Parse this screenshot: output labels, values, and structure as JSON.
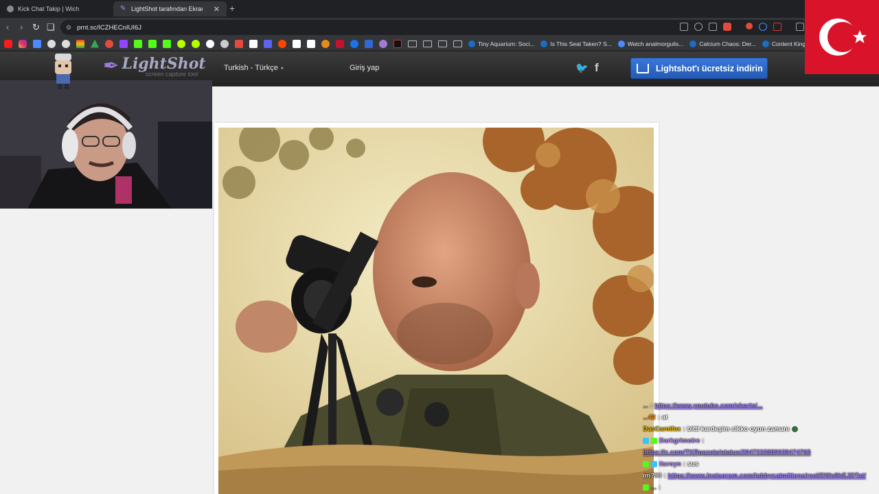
{
  "tabs": [
    {
      "title": "Kick Chat Takip | Wich"
    },
    {
      "title": "LightShot tarafından Ekran Görü"
    }
  ],
  "address_bar": {
    "url": "prnt.sc/ICZHECnIUI6J"
  },
  "bookmarks": [
    {
      "label": "Tiny Aquarium: Soci..."
    },
    {
      "label": "Is This Seat Taken? S..."
    },
    {
      "label": "Watch analmorgulis..."
    },
    {
      "label": "Calcium Chaos: Der..."
    },
    {
      "label": "Content King Stean"
    }
  ],
  "lightshot": {
    "logo_name": "LightShot",
    "logo_subtitle": "screen capture tool",
    "language": "Turkish - Türkçe",
    "login": "Giriş yap",
    "download_button": "Lightshot'ı ücretsiz indirin"
  },
  "chat": [
    {
      "user": "...",
      "message": "https://www.youtube.com/shorts/..."
    },
    {
      "user": "...42",
      "message": "at"
    },
    {
      "user": "DasCarnifex",
      "message": "bitti kardeşim sikko oyun zamanı"
    },
    {
      "user": "Darkgrimoire",
      "message": ""
    },
    {
      "user": "",
      "message": "https://x.com/TKRgazete/status/2047233889039474765"
    },
    {
      "user": "ltsroyn",
      "message": "sus"
    },
    {
      "user": "im?99",
      "message": "https://www.instagram.com/tabbycatmittens/reel/DWs9hEJDTat/"
    },
    {
      "user": "...",
      "message": ""
    }
  ],
  "colors": {
    "accent": "#2f6bd0",
    "flag_red": "#d9142a",
    "chat_user": "#b58cff"
  }
}
